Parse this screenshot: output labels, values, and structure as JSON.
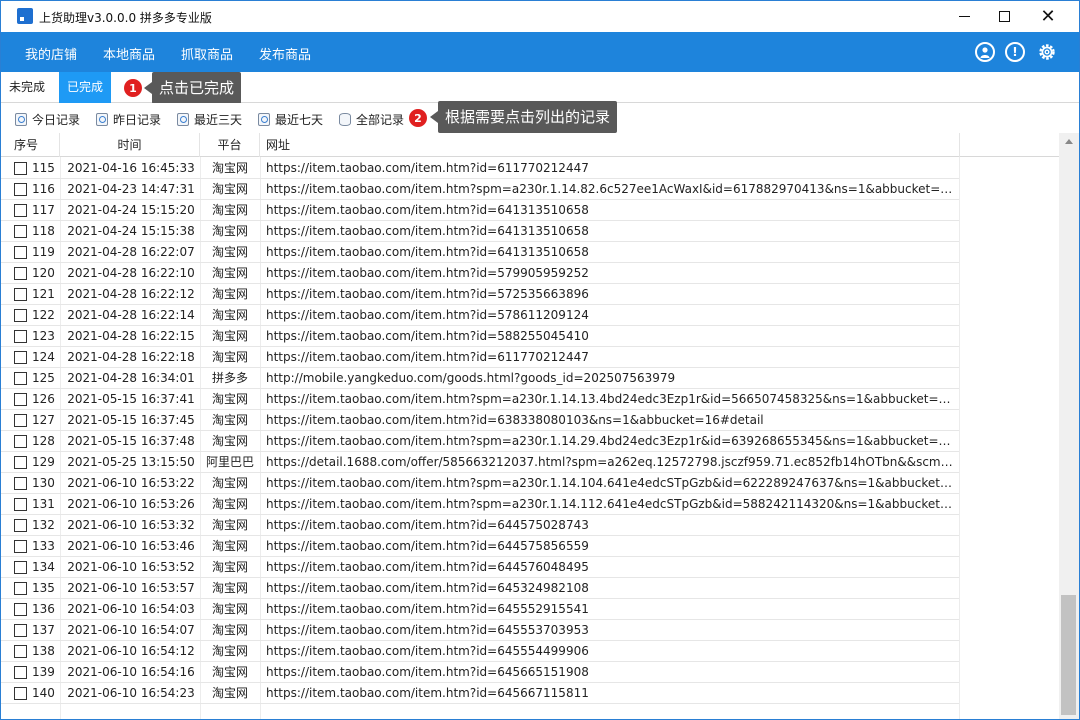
{
  "window": {
    "title": "上货助理v3.0.0.0 拼多多专业版",
    "minimize": "–",
    "close": "✕"
  },
  "menu": {
    "items": [
      "我的店铺",
      "本地商品",
      "抓取商品",
      "发布商品"
    ],
    "icons": [
      "user-icon",
      "info-icon",
      "gear-icon"
    ]
  },
  "status_tabs": {
    "pending": "未完成",
    "done": "已完成",
    "active": "已完成"
  },
  "annotations": [
    {
      "number": "1",
      "text": "点击已完成"
    },
    {
      "number": "2",
      "text": "根据需要点击列出的记录"
    }
  ],
  "filters": [
    "今日记录",
    "昨日记录",
    "最近三天",
    "最近七天",
    "全部记录"
  ],
  "table": {
    "headers": [
      "序号",
      "时间",
      "平台",
      "网址"
    ],
    "rows": [
      {
        "seq": "115",
        "time": "2021-04-16 16:45:33",
        "platform": "淘宝网",
        "url": "https://item.taobao.com/item.htm?id=611770212447"
      },
      {
        "seq": "116",
        "time": "2021-04-23 14:47:31",
        "platform": "淘宝网",
        "url": "https://item.taobao.com/item.htm?spm=a230r.1.14.82.6c527ee1AcWaxI&id=617882970413&ns=1&abbucket=16#de..."
      },
      {
        "seq": "117",
        "time": "2021-04-24 15:15:20",
        "platform": "淘宝网",
        "url": "https://item.taobao.com/item.htm?id=641313510658"
      },
      {
        "seq": "118",
        "time": "2021-04-24 15:15:38",
        "platform": "淘宝网",
        "url": "https://item.taobao.com/item.htm?id=641313510658"
      },
      {
        "seq": "119",
        "time": "2021-04-28 16:22:07",
        "platform": "淘宝网",
        "url": "https://item.taobao.com/item.htm?id=641313510658"
      },
      {
        "seq": "120",
        "time": "2021-04-28 16:22:10",
        "platform": "淘宝网",
        "url": "https://item.taobao.com/item.htm?id=579905959252"
      },
      {
        "seq": "121",
        "time": "2021-04-28 16:22:12",
        "platform": "淘宝网",
        "url": "https://item.taobao.com/item.htm?id=572535663896"
      },
      {
        "seq": "122",
        "time": "2021-04-28 16:22:14",
        "platform": "淘宝网",
        "url": "https://item.taobao.com/item.htm?id=578611209124"
      },
      {
        "seq": "123",
        "time": "2021-04-28 16:22:15",
        "platform": "淘宝网",
        "url": "https://item.taobao.com/item.htm?id=588255045410"
      },
      {
        "seq": "124",
        "time": "2021-04-28 16:22:18",
        "platform": "淘宝网",
        "url": "https://item.taobao.com/item.htm?id=611770212447"
      },
      {
        "seq": "125",
        "time": "2021-04-28 16:34:01",
        "platform": "拼多多",
        "url": "http://mobile.yangkeduo.com/goods.html?goods_id=202507563979"
      },
      {
        "seq": "126",
        "time": "2021-05-15 16:37:41",
        "platform": "淘宝网",
        "url": "https://item.taobao.com/item.htm?spm=a230r.1.14.13.4bd24edc3Ezp1r&id=566507458325&ns=1&abbucket=16#de..."
      },
      {
        "seq": "127",
        "time": "2021-05-15 16:37:45",
        "platform": "淘宝网",
        "url": "https://item.taobao.com/item.htm?id=638338080103&ns=1&abbucket=16#detail"
      },
      {
        "seq": "128",
        "time": "2021-05-15 16:37:48",
        "platform": "淘宝网",
        "url": "https://item.taobao.com/item.htm?spm=a230r.1.14.29.4bd24edc3Ezp1r&id=639268655345&ns=1&abbucket=16#de..."
      },
      {
        "seq": "129",
        "time": "2021-05-25 13:15:50",
        "platform": "阿里巴巴",
        "url": "https://detail.1688.com/offer/585663212037.html?spm=a262eq.12572798.jsczf959.71.ec852fb14hOTbn&&scm=1007...."
      },
      {
        "seq": "130",
        "time": "2021-06-10 16:53:22",
        "platform": "淘宝网",
        "url": "https://item.taobao.com/item.htm?spm=a230r.1.14.104.641e4edcSTpGzb&id=622289247637&ns=1&abbucket=3#de..."
      },
      {
        "seq": "131",
        "time": "2021-06-10 16:53:26",
        "platform": "淘宝网",
        "url": "https://item.taobao.com/item.htm?spm=a230r.1.14.112.641e4edcSTpGzb&id=588242114320&ns=1&abbucket=3#de..."
      },
      {
        "seq": "132",
        "time": "2021-06-10 16:53:32",
        "platform": "淘宝网",
        "url": "https://item.taobao.com/item.htm?id=644575028743"
      },
      {
        "seq": "133",
        "time": "2021-06-10 16:53:46",
        "platform": "淘宝网",
        "url": "https://item.taobao.com/item.htm?id=644575856559"
      },
      {
        "seq": "134",
        "time": "2021-06-10 16:53:52",
        "platform": "淘宝网",
        "url": "https://item.taobao.com/item.htm?id=644576048495"
      },
      {
        "seq": "135",
        "time": "2021-06-10 16:53:57",
        "platform": "淘宝网",
        "url": "https://item.taobao.com/item.htm?id=645324982108"
      },
      {
        "seq": "136",
        "time": "2021-06-10 16:54:03",
        "platform": "淘宝网",
        "url": "https://item.taobao.com/item.htm?id=645552915541"
      },
      {
        "seq": "137",
        "time": "2021-06-10 16:54:07",
        "platform": "淘宝网",
        "url": "https://item.taobao.com/item.htm?id=645553703953"
      },
      {
        "seq": "138",
        "time": "2021-06-10 16:54:12",
        "platform": "淘宝网",
        "url": "https://item.taobao.com/item.htm?id=645554499906"
      },
      {
        "seq": "139",
        "time": "2021-06-10 16:54:16",
        "platform": "淘宝网",
        "url": "https://item.taobao.com/item.htm?id=645665151908"
      },
      {
        "seq": "140",
        "time": "2021-06-10 16:54:23",
        "platform": "淘宝网",
        "url": "https://item.taobao.com/item.htm?id=645667115811"
      }
    ]
  },
  "colors": {
    "menu_bar": "#1e84dc",
    "active_tab": "#1e9af5",
    "badge": "#e02020",
    "callout": "#595959"
  }
}
